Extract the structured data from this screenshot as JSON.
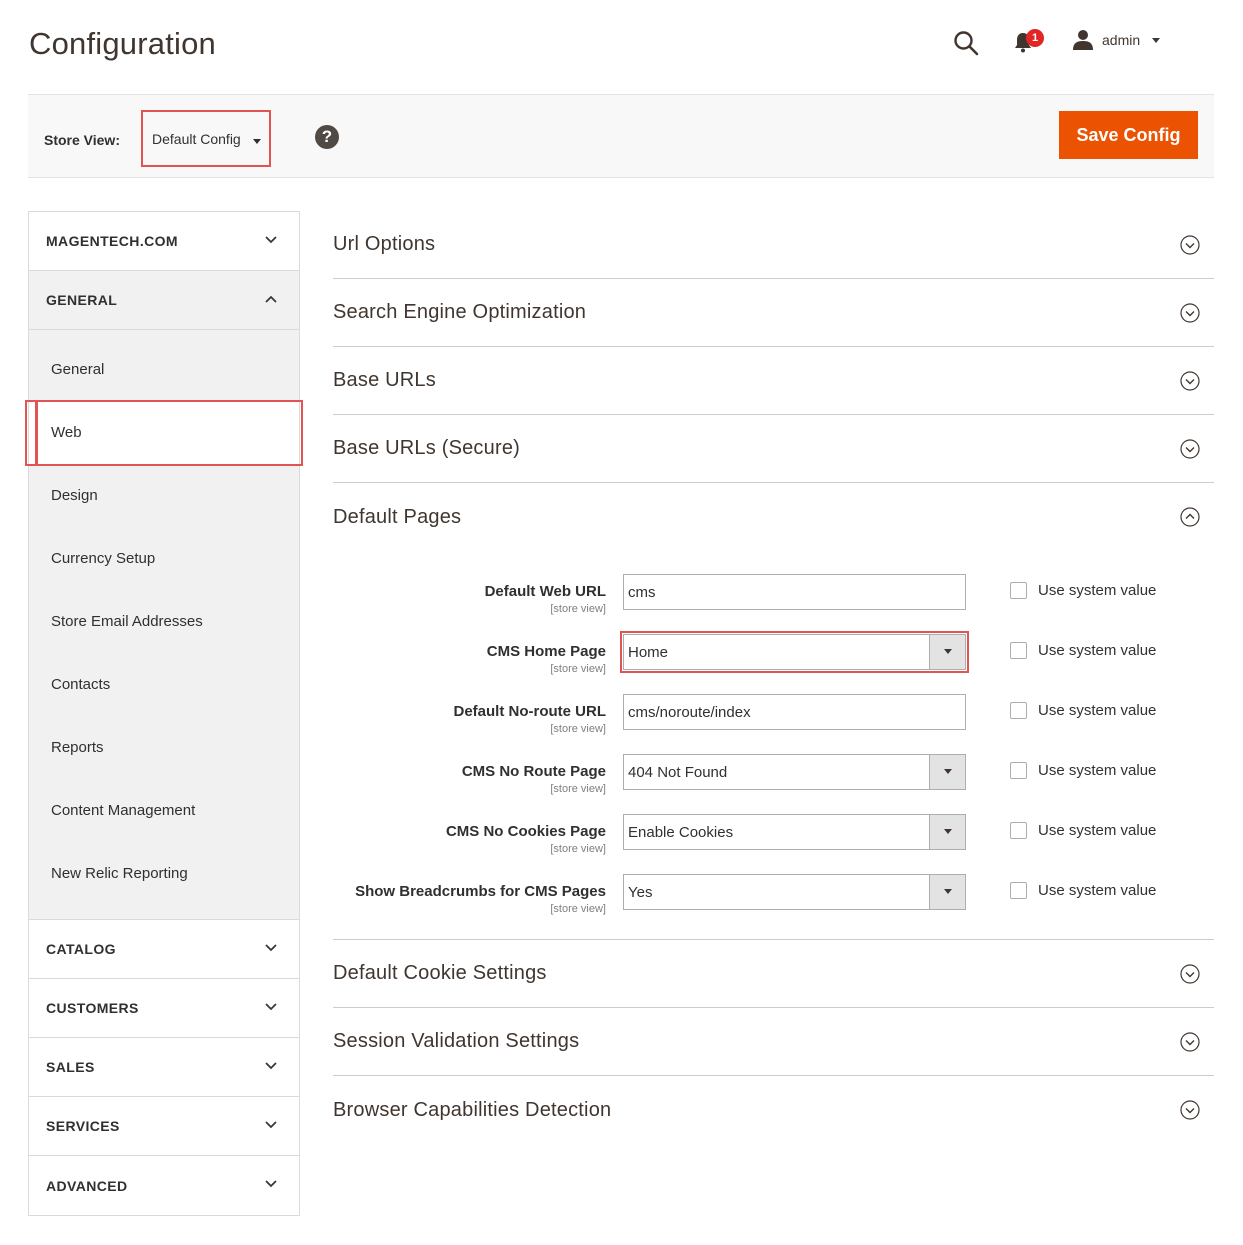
{
  "header": {
    "title": "Configuration",
    "notification_count": "1",
    "user_label": "admin"
  },
  "store_bar": {
    "label": "Store View:",
    "selected_scope": "Default Config",
    "help_icon": "?",
    "save_label": "Save Config"
  },
  "sidebar": {
    "groups": [
      {
        "label": "MAGENTECH.COM",
        "open": false
      },
      {
        "label": "GENERAL",
        "open": true
      },
      {
        "label": "CATALOG",
        "open": false
      },
      {
        "label": "CUSTOMERS",
        "open": false
      },
      {
        "label": "SALES",
        "open": false
      },
      {
        "label": "SERVICES",
        "open": false
      },
      {
        "label": "ADVANCED",
        "open": false
      }
    ],
    "general_items": [
      {
        "label": "General"
      },
      {
        "label": "Web",
        "active": true
      },
      {
        "label": "Design"
      },
      {
        "label": "Currency Setup"
      },
      {
        "label": "Store Email Addresses"
      },
      {
        "label": "Contacts"
      },
      {
        "label": "Reports"
      },
      {
        "label": "Content Management"
      },
      {
        "label": "New Relic Reporting"
      }
    ]
  },
  "sections": {
    "before": [
      {
        "title": "Url Options"
      },
      {
        "title": "Search Engine Optimization"
      },
      {
        "title": "Base URLs"
      },
      {
        "title": "Base URLs (Secure)"
      }
    ],
    "expanded_title": "Default Pages",
    "after": [
      {
        "title": "Default Cookie Settings"
      },
      {
        "title": "Session Validation Settings"
      },
      {
        "title": "Browser Capabilities Detection"
      }
    ]
  },
  "default_pages": {
    "scope_label": "[store view]",
    "system_value_label": "Use system value",
    "fields": [
      {
        "label": "Default Web URL",
        "type": "text",
        "value": "cms"
      },
      {
        "label": "CMS Home Page",
        "type": "select",
        "value": "Home",
        "highlighted": true
      },
      {
        "label": "Default No-route URL",
        "type": "text",
        "value": "cms/noroute/index"
      },
      {
        "label": "CMS No Route Page",
        "type": "select",
        "value": "404 Not Found"
      },
      {
        "label": "CMS No Cookies Page",
        "type": "select",
        "value": "Enable Cookies"
      },
      {
        "label": "Show Breadcrumbs for CMS Pages",
        "type": "select",
        "value": "Yes"
      }
    ]
  },
  "icons": {
    "search": "search-icon",
    "bell": "bell-icon",
    "user": "user-icon",
    "chevron_down": "chevron-down-icon",
    "chevron_up": "chevron-up-icon",
    "circle_chevron": "circle-chevron-icon"
  },
  "colors": {
    "accent": "#eb5202",
    "highlight": "#e05454",
    "notification": "#e22626"
  }
}
